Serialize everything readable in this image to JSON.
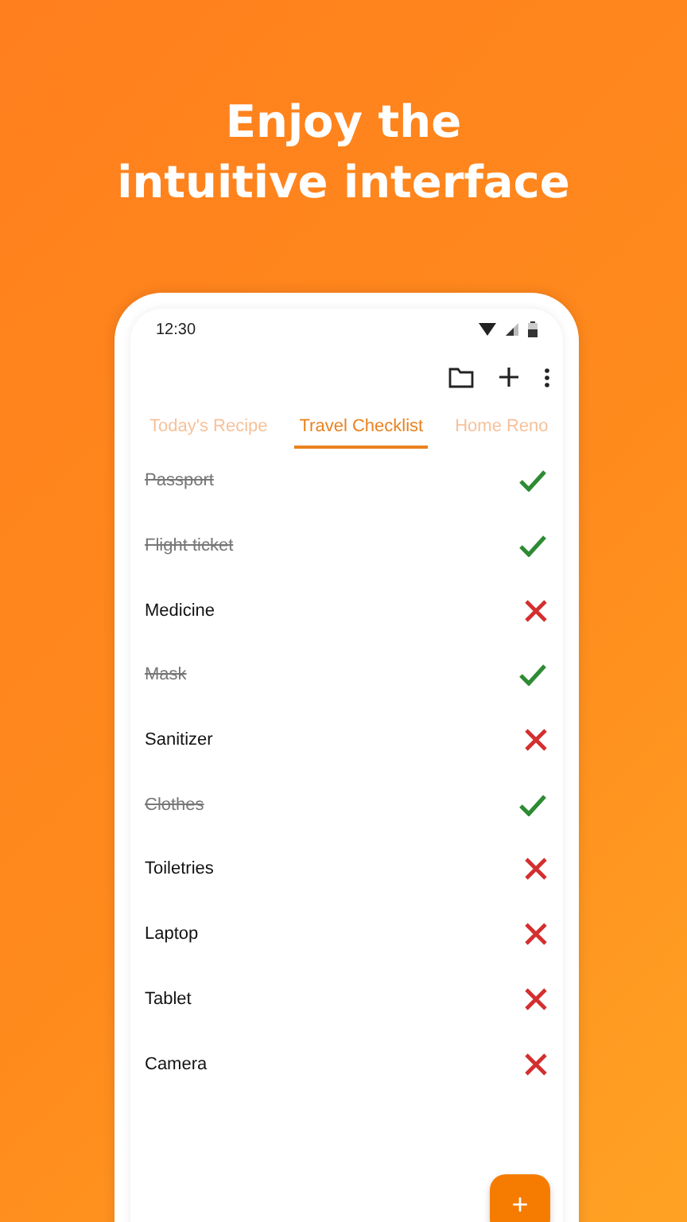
{
  "headline": [
    "Enjoy the",
    "intuitive interface"
  ],
  "status_bar": {
    "time": "12:30"
  },
  "tabs": [
    {
      "label": "Today's Recipe",
      "selected": false
    },
    {
      "label": "Travel Checklist",
      "selected": true
    },
    {
      "label": "Home Reno",
      "selected": false
    }
  ],
  "items": [
    {
      "label": "Passport",
      "done": true
    },
    {
      "label": "Flight ticket",
      "done": true
    },
    {
      "label": "Medicine",
      "done": false
    },
    {
      "label": "Mask",
      "done": true
    },
    {
      "label": "Sanitizer",
      "done": false
    },
    {
      "label": "Clothes",
      "done": true
    },
    {
      "label": "Toiletries",
      "done": false
    },
    {
      "label": "Laptop",
      "done": false
    },
    {
      "label": "Tablet",
      "done": false
    },
    {
      "label": "Camera",
      "done": false
    }
  ],
  "fab": "+"
}
